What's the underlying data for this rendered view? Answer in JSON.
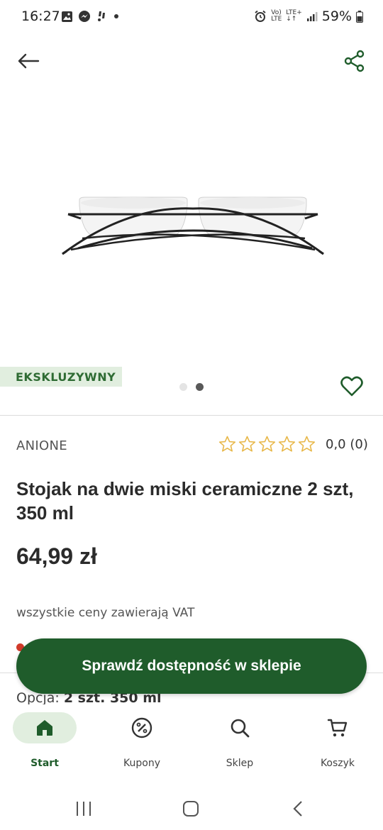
{
  "status_bar": {
    "time": "16:27",
    "network": "LTE+",
    "battery": "59%"
  },
  "colors": {
    "brand_green": "#1f5c2b",
    "badge_bg": "#e1eedf",
    "star": "#e8b84a"
  },
  "product": {
    "badge": "EKSKLUZYWNY",
    "brand": "ANIONE",
    "rating": "0,0 (0)",
    "title": "Stojak na dwie miski ceramiczne 2 szt, 350 ml",
    "price": "64,99 zł",
    "vat_note": "wszystkie ceny zawierają VAT",
    "option_label": "Opcja:",
    "option_value": "2 szt. 350 ml",
    "gallery_count": 2,
    "gallery_active": 2
  },
  "cta": {
    "label": "Sprawdź dostępność w sklepie"
  },
  "bottom_nav": {
    "items": [
      {
        "label": "Start",
        "icon": "home-icon"
      },
      {
        "label": "Kupony",
        "icon": "coupon-percent-icon"
      },
      {
        "label": "Sklep",
        "icon": "search-icon"
      },
      {
        "label": "Koszyk",
        "icon": "cart-icon"
      }
    ]
  }
}
